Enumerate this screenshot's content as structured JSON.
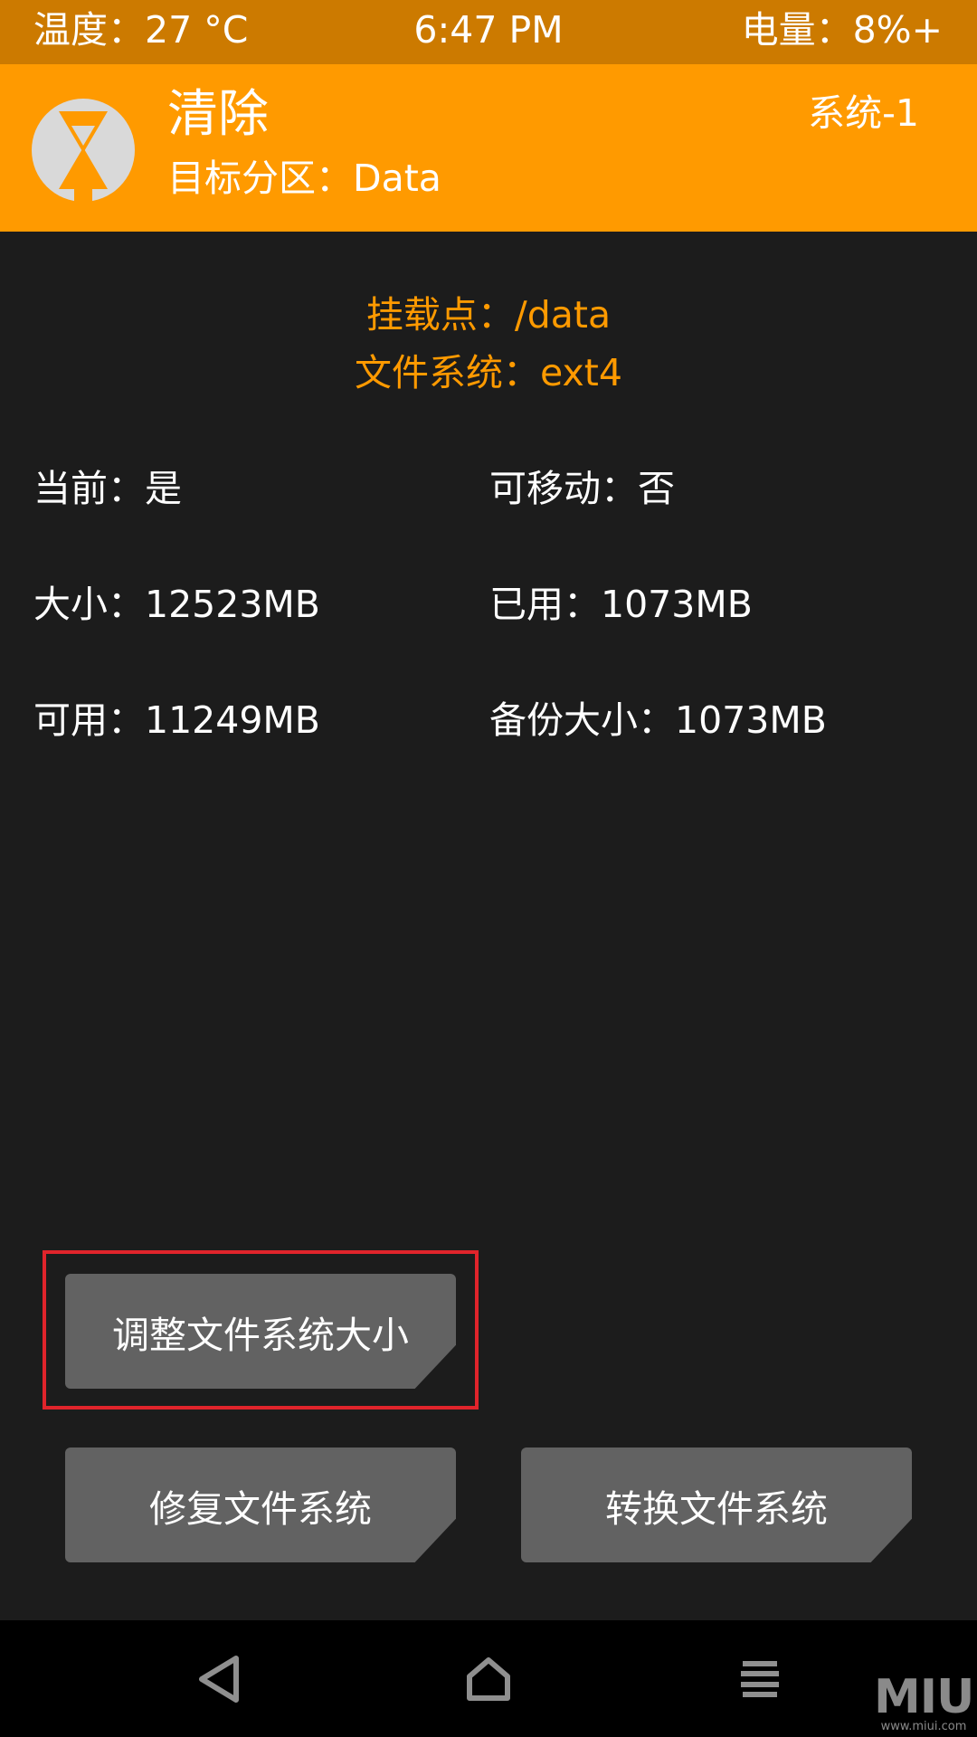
{
  "status_bar": {
    "temperature": "温度：27 °C",
    "time": "6:47 PM",
    "battery": "电量：8%+"
  },
  "header": {
    "logo_icon": "twrp-logo-icon",
    "title": "清除",
    "subtitle": "目标分区：Data",
    "system_slot": "系统-1"
  },
  "partition": {
    "mount_point": "挂载点：/data",
    "file_system": "文件系统：ext4",
    "current": "当前：是",
    "removable": "可移动：否",
    "size": "大小：12523MB",
    "used": "已用：1073MB",
    "free": "可用：11249MB",
    "backup_size": "备份大小：1073MB"
  },
  "buttons": {
    "resize_fs": "调整文件系统大小",
    "repair_fs": "修复文件系统",
    "change_fs": "转换文件系统"
  },
  "nav": {
    "back_icon": "back-triangle-icon",
    "home_icon": "home-icon",
    "menu_icon": "menu-lines-icon"
  },
  "watermark": {
    "logo": "MIUI",
    "url": "www.miui.com"
  },
  "colors": {
    "accent": "#ff9a00",
    "status_bar": "#cc7a00",
    "background": "#1c1c1c",
    "button": "#626262",
    "highlight": "#e0242b",
    "nav_bar": "#000000"
  }
}
